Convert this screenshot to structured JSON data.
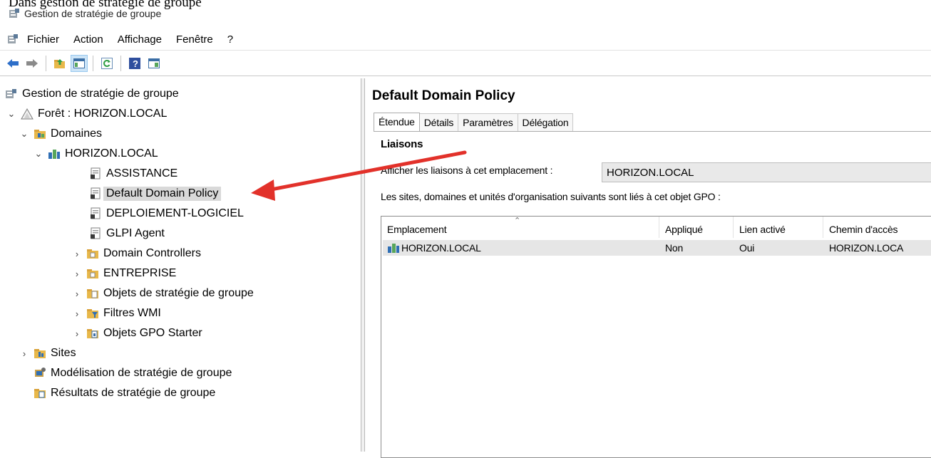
{
  "caption": "Dans gestion de stratégie de groupe",
  "window": {
    "title": "Gestion de stratégie de groupe"
  },
  "menu": {
    "items": [
      "Fichier",
      "Action",
      "Affichage",
      "Fenêtre",
      "?"
    ]
  },
  "toolbar": {
    "buttons": [
      "back-icon",
      "forward-icon",
      "up-folder-icon",
      "show-hide-tree-icon",
      "refresh-icon",
      "help-icon",
      "properties-icon"
    ]
  },
  "tree": {
    "root": "Gestion de stratégie de groupe",
    "forest": "Forêt : HORIZON.LOCAL",
    "domains": "Domaines",
    "domain": "HORIZON.LOCAL",
    "children": [
      "ASSISTANCE",
      "Default Domain Policy",
      "DEPLOIEMENT-LOGICIEL",
      "GLPI Agent",
      "Domain Controllers",
      "ENTREPRISE",
      "Objets de stratégie de groupe",
      "Filtres WMI",
      "Objets GPO Starter"
    ],
    "sites": "Sites",
    "modeling": "Modélisation de stratégie de groupe",
    "results": "Résultats de stratégie de groupe",
    "selected": "Default Domain Policy"
  },
  "detail": {
    "title": "Default Domain Policy",
    "tabs": [
      "Étendue",
      "Détails",
      "Paramètres",
      "Délégation"
    ],
    "active_tab": "Étendue",
    "section": "Liaisons",
    "show_links_label": "Afficher les liaisons à cet emplacement :",
    "show_links_value": "HORIZON.LOCAL",
    "description": "Les sites, domaines et unités d'organisation suivants sont liés à cet objet GPO :",
    "columns": [
      "Emplacement",
      "Appliqué",
      "Lien activé",
      "Chemin d'accès"
    ],
    "rows": [
      {
        "location": "HORIZON.LOCAL",
        "enforced": "Non",
        "enabled": "Oui",
        "path": "HORIZON.LOCA"
      }
    ]
  },
  "annotation": {
    "color": "#e2312a"
  }
}
